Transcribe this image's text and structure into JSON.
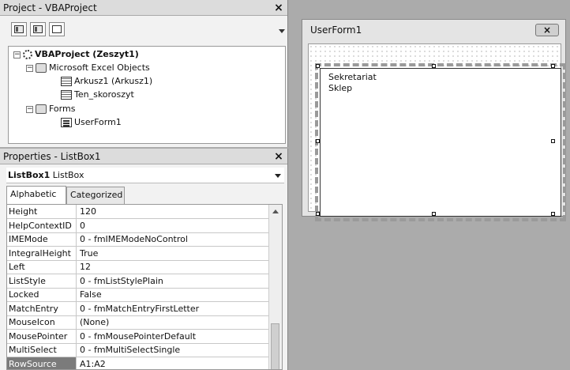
{
  "project": {
    "title": "Project - VBAProject",
    "close_label": "×",
    "toolbar": [
      "view-code-icon",
      "view-object-icon",
      "toggle-folders-icon"
    ],
    "tree": {
      "root": "VBAProject (Zeszyt1)",
      "excel_objects": "Microsoft Excel Objects",
      "sheet1": "Arkusz1 (Arkusz1)",
      "workbook": "Ten_skoroszyt",
      "forms": "Forms",
      "userform": "UserForm1"
    }
  },
  "properties": {
    "title": "Properties - ListBox1",
    "close_label": "×",
    "object_name": "ListBox1",
    "object_type": "ListBox",
    "tabs": [
      "Alphabetic",
      "Categorized"
    ],
    "active_tab": "Alphabetic",
    "rows": [
      {
        "name": "Height",
        "value": "120"
      },
      {
        "name": "HelpContextID",
        "value": "0"
      },
      {
        "name": "IMEMode",
        "value": "0 - fmIMEModeNoControl"
      },
      {
        "name": "IntegralHeight",
        "value": "True"
      },
      {
        "name": "Left",
        "value": "12"
      },
      {
        "name": "ListStyle",
        "value": "0 - fmListStylePlain"
      },
      {
        "name": "Locked",
        "value": "False"
      },
      {
        "name": "MatchEntry",
        "value": "0 - fmMatchEntryFirstLetter"
      },
      {
        "name": "MouseIcon",
        "value": "(None)"
      },
      {
        "name": "MousePointer",
        "value": "0 - fmMousePointerDefault"
      },
      {
        "name": "MultiSelect",
        "value": "0 - fmMultiSelectSingle"
      },
      {
        "name": "RowSource",
        "value": "A1:A2"
      }
    ],
    "selected_row": "RowSource"
  },
  "form": {
    "title": "UserForm1",
    "close_label": "×",
    "listbox_items": [
      "Sekretariat",
      "Sklep"
    ]
  }
}
